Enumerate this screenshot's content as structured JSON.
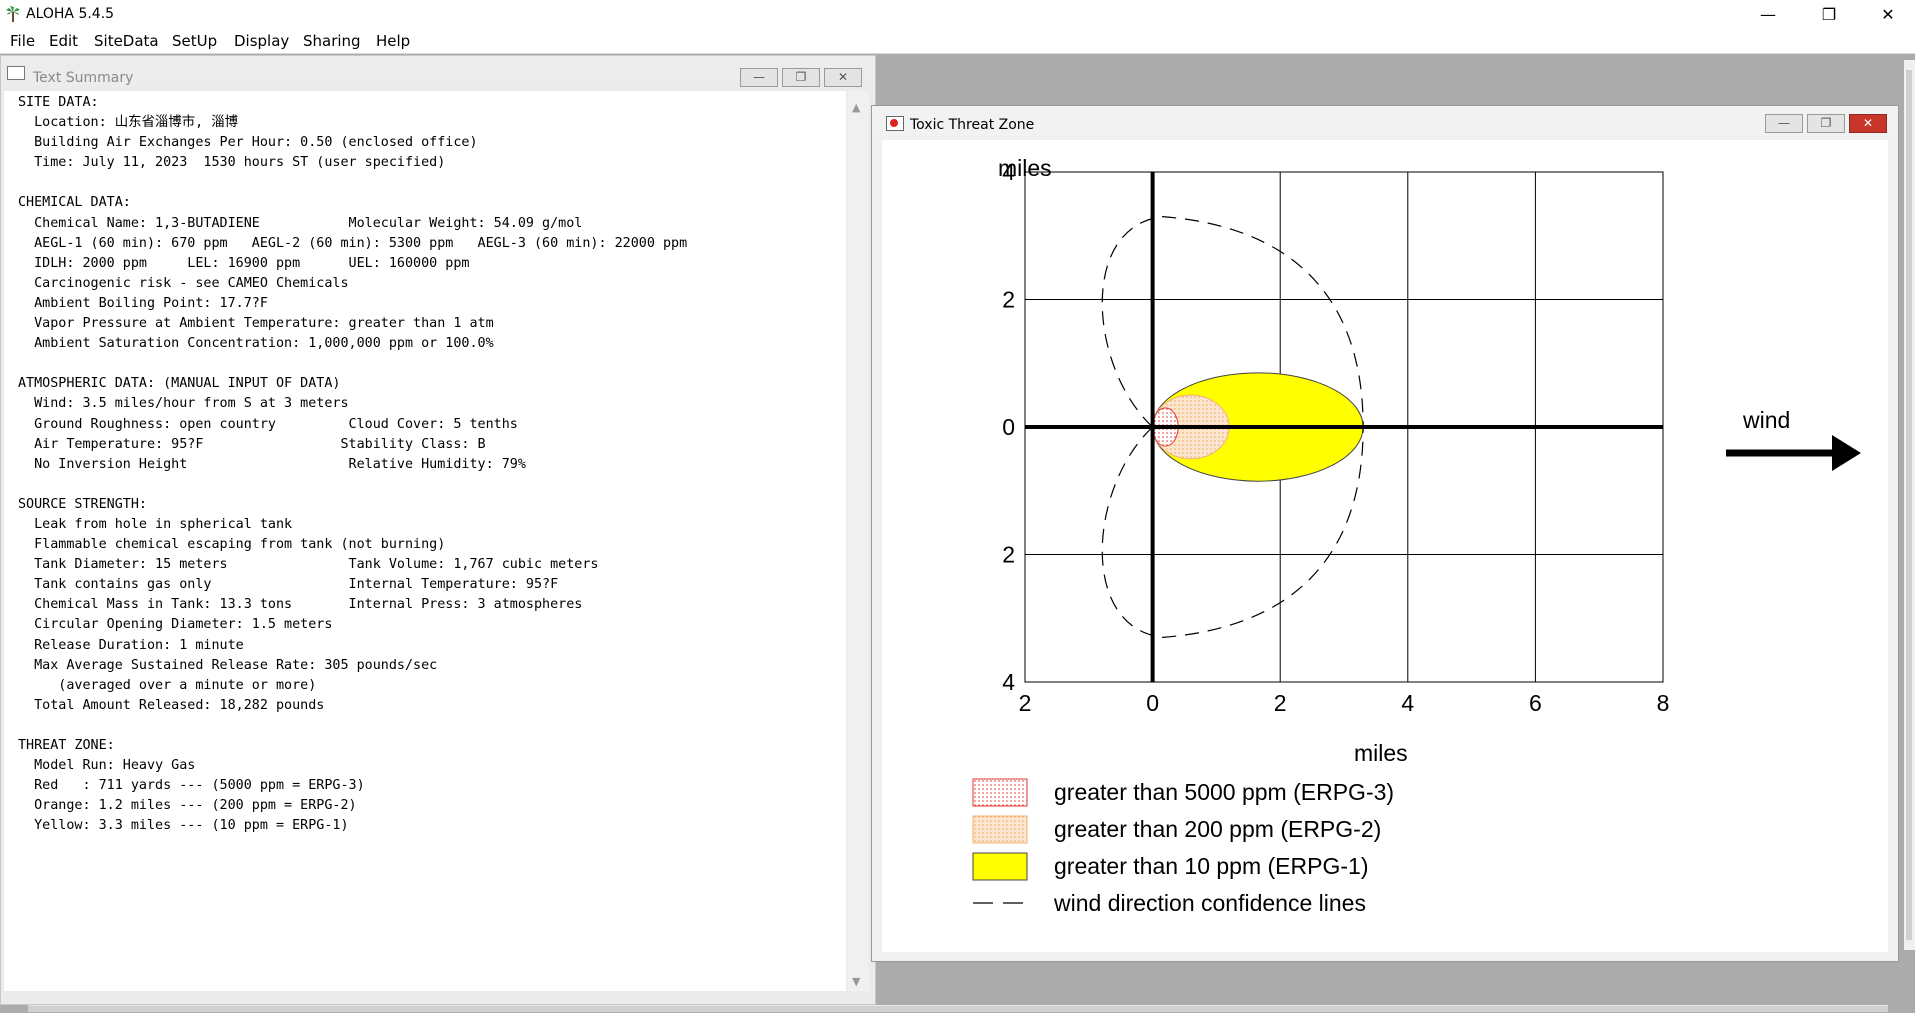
{
  "app": {
    "title": "ALOHA 5.4.5"
  },
  "window_controls": {
    "minimize": "—",
    "restore": "❐",
    "close": "✕"
  },
  "menu": [
    "File",
    "Edit",
    "SiteData",
    "SetUp",
    "Display",
    "Sharing",
    "Help"
  ],
  "text_summary": {
    "title": "Text Summary",
    "lines": [
      "SITE DATA:",
      "  Location: 山东省淄博市, 淄博",
      "  Building Air Exchanges Per Hour: 0.50 (enclosed office)",
      "  Time: July 11, 2023  1530 hours ST (user specified)",
      "",
      "CHEMICAL DATA:",
      "  Chemical Name: 1,3-BUTADIENE           Molecular Weight: 54.09 g/mol",
      "  AEGL-1 (60 min): 670 ppm   AEGL-2 (60 min): 5300 ppm   AEGL-3 (60 min): 22000 ppm",
      "  IDLH: 2000 ppm     LEL: 16900 ppm      UEL: 160000 ppm",
      "  Carcinogenic risk - see CAMEO Chemicals",
      "  Ambient Boiling Point: 17.7?F",
      "  Vapor Pressure at Ambient Temperature: greater than 1 atm",
      "  Ambient Saturation Concentration: 1,000,000 ppm or 100.0%",
      "",
      "ATMOSPHERIC DATA: (MANUAL INPUT OF DATA)",
      "  Wind: 3.5 miles/hour from S at 3 meters",
      "  Ground Roughness: open country         Cloud Cover: 5 tenths",
      "  Air Temperature: 95?F                 Stability Class: B",
      "  No Inversion Height                    Relative Humidity: 79%",
      "",
      "SOURCE STRENGTH:",
      "  Leak from hole in spherical tank",
      "  Flammable chemical escaping from tank (not burning)",
      "  Tank Diameter: 15 meters               Tank Volume: 1,767 cubic meters",
      "  Tank contains gas only                 Internal Temperature: 95?F",
      "  Chemical Mass in Tank: 13.3 tons       Internal Press: 3 atmospheres",
      "  Circular Opening Diameter: 1.5 meters",
      "  Release Duration: 1 minute",
      "  Max Average Sustained Release Rate: 305 pounds/sec",
      "     (averaged over a minute or more)",
      "  Total Amount Released: 18,282 pounds",
      "",
      "THREAT ZONE:",
      "  Model Run: Heavy Gas",
      "  Red   : 711 yards --- (5000 ppm = ERPG-3)",
      "  Orange: 1.2 miles --- (200 ppm = ERPG-2)",
      "  Yellow: 3.3 miles --- (10 ppm = ERPG-1)"
    ]
  },
  "threat_zone_window": {
    "title": "Toxic Threat Zone"
  },
  "chart_data": {
    "type": "area",
    "ylabel": "miles",
    "xlabel": "miles",
    "xlim": [
      -2,
      8
    ],
    "ylim": [
      -4,
      4
    ],
    "x_ticks": [
      -2,
      0,
      2,
      4,
      6,
      8
    ],
    "x_tick_labels": [
      "2",
      "0",
      "2",
      "4",
      "6",
      "8"
    ],
    "y_ticks": [
      4,
      2,
      0,
      -2,
      -4
    ],
    "y_tick_labels": [
      "4",
      "2",
      "0",
      "2",
      "4"
    ],
    "grid": true,
    "wind_label": "wind",
    "zones": [
      {
        "name": "greater than 5000 ppm (ERPG-3)",
        "color": "#e53935",
        "x_min": 0.0,
        "x_max": 0.4,
        "half_width": 0.3
      },
      {
        "name": "greater than 200 ppm (ERPG-2)",
        "color": "#f6c08a",
        "x_min": 0.0,
        "x_max": 1.2,
        "half_width": 0.5
      },
      {
        "name": "greater than 10 ppm (ERPG-1)",
        "color": "#ffff00",
        "x_min": 0.0,
        "x_max": 3.3,
        "half_width": 0.85
      }
    ],
    "confidence_line_label": "wind direction confidence lines",
    "confidence_line_reach": 3.3
  }
}
